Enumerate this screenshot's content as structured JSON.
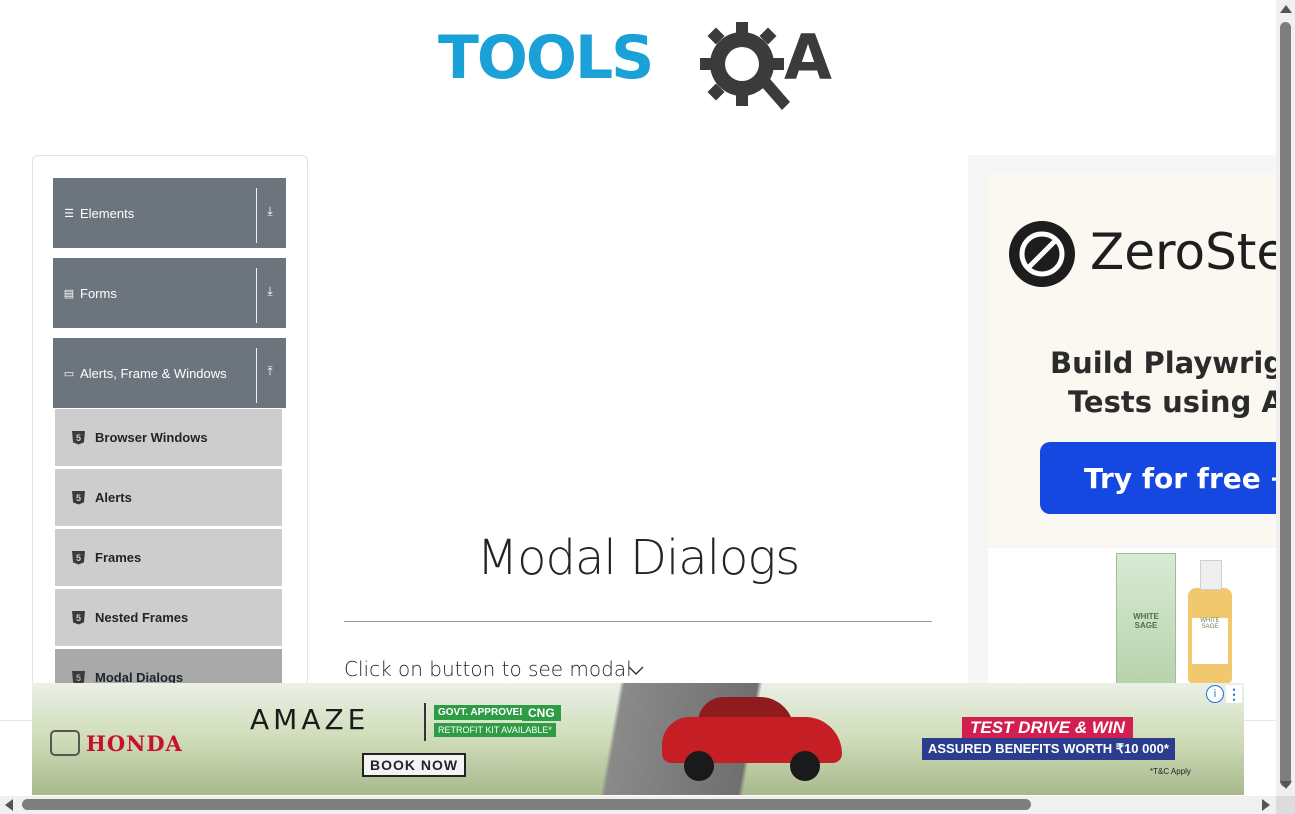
{
  "header": {
    "logo_main": "TOOLS",
    "logo_end": "A"
  },
  "sidebar": {
    "groups": [
      {
        "label": "Elements",
        "icon": "menu-icon",
        "arrow": "⤓"
      },
      {
        "label": "Forms",
        "icon": "form-icon",
        "arrow": "⤓"
      },
      {
        "label": "Alerts, Frame & Windows",
        "icon": "window-icon",
        "arrow": "⤒"
      }
    ],
    "items": [
      {
        "label": "Browser Windows",
        "badge": "5"
      },
      {
        "label": "Alerts",
        "badge": "5"
      },
      {
        "label": "Frames",
        "badge": "5"
      },
      {
        "label": "Nested Frames",
        "badge": "5"
      },
      {
        "label": "Modal Dialogs",
        "badge": "5",
        "active": true
      }
    ]
  },
  "main": {
    "title": "Modal Dialogs",
    "instruction": "Click on button to see modal"
  },
  "right_ad": {
    "brand": "ZeroSte",
    "line1": "Build Playwrigh",
    "line2": "Tests using A",
    "cta": "Try for free →",
    "product1_label": "WHITE SAGE",
    "product2_label": "WHITE SAGE"
  },
  "bottom_ad": {
    "brand": "HONDA",
    "model": "AMAZE",
    "govt": "GOVT. APPROVED",
    "cng": "CNG",
    "retrofit": "RETROFIT KIT AVAILABLE*",
    "book": "BOOK NOW",
    "test_drive": "TEST DRIVE & WIN",
    "benefits": "ASSURED BENEFITS WORTH ₹10 000*",
    "tc": "*T&C Apply",
    "info": "i",
    "more": "⋮"
  },
  "colors": {
    "sidebar_header": "#6c757d",
    "sidebar_item": "#cdcdcd",
    "sidebar_item_active": "#a9a9a9",
    "logo_blue": "#1aa1d8",
    "cta_blue": "#1448e0"
  }
}
